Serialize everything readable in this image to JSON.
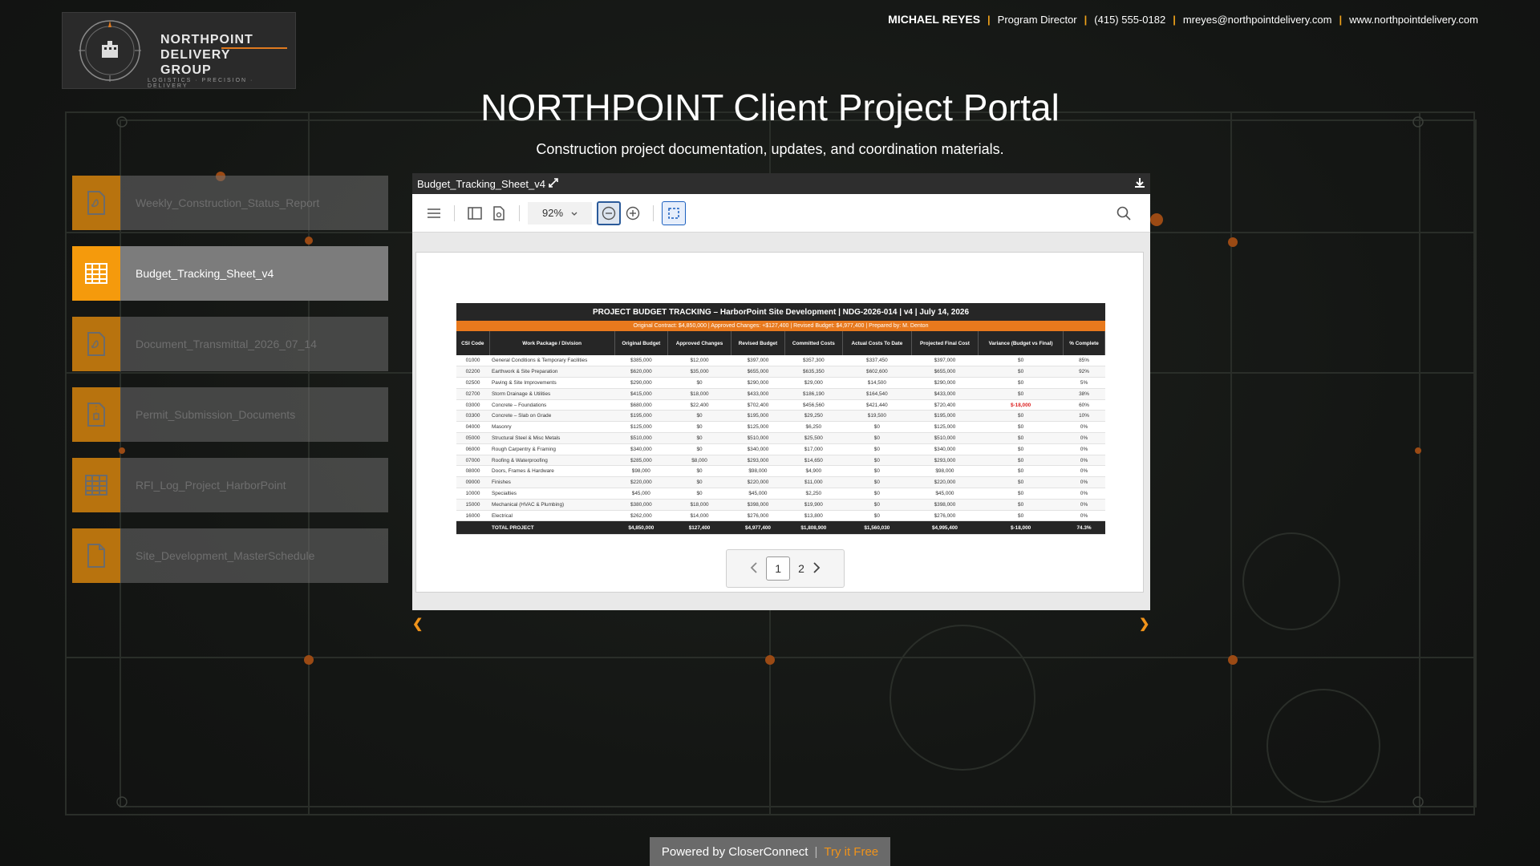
{
  "logo": {
    "brand_line1": "NORTHPOINT",
    "brand_line2": "DELIVERY",
    "brand_line3": "GROUP",
    "tagline": "LOGISTICS · PRECISION · DELIVERY"
  },
  "contact": {
    "name": "MICHAEL REYES",
    "role": "Program Director",
    "phone": "(415) 555-0182",
    "email": "mreyes@northpointdelivery.com",
    "website": "www.northpointdelivery.com"
  },
  "title": "NORTHPOINT Client Project Portal",
  "subtitle": "Construction project documentation, updates, and coordination materials.",
  "documents": [
    {
      "label": "Weekly_Construction_Status_Report",
      "icon": "pdf-icon"
    },
    {
      "label": "Budget_Tracking_Sheet_v4",
      "icon": "spreadsheet-icon",
      "active": true
    },
    {
      "label": "Document_Transmittal_2026_07_14",
      "icon": "pdf-icon"
    },
    {
      "label": "Permit_Submission_Documents",
      "icon": "zip-icon"
    },
    {
      "label": "RFI_Log_Project_HarborPoint",
      "icon": "spreadsheet-icon"
    },
    {
      "label": "Site_Development_MasterSchedule",
      "icon": "file-icon"
    }
  ],
  "viewer": {
    "filename": "Budget_Tracking_Sheet_v4",
    "zoom": "92%",
    "current_page": "1",
    "next_page": "2"
  },
  "sheet": {
    "title": "PROJECT BUDGET TRACKING  –  HarborPoint Site Development  |  NDG-2026-014  |  v4  |  July 14, 2026",
    "subtitle": "Original Contract: $4,850,000  |  Approved Changes: +$127,400  |  Revised Budget: $4,977,400  |  Prepared by: M. Denton",
    "headers": [
      "CSI Code",
      "Work Package / Division",
      "Original Budget",
      "Approved Changes",
      "Revised Budget",
      "Committed Costs",
      "Actual Costs To Date",
      "Projected Final Cost",
      "Variance (Budget vs Final)",
      "% Complete"
    ],
    "rows": [
      [
        "01000",
        "General Conditions & Temporary Facilities",
        "$385,000",
        "$12,000",
        "$397,000",
        "$357,300",
        "$337,450",
        "$397,000",
        "$0",
        "85%"
      ],
      [
        "02200",
        "Earthwork & Site Preparation",
        "$620,000",
        "$35,000",
        "$655,000",
        "$635,350",
        "$602,600",
        "$655,000",
        "$0",
        "92%"
      ],
      [
        "02500",
        "Paving & Site Improvements",
        "$290,000",
        "$0",
        "$290,000",
        "$29,000",
        "$14,500",
        "$290,000",
        "$0",
        "5%"
      ],
      [
        "02700",
        "Storm Drainage & Utilities",
        "$415,000",
        "$18,000",
        "$433,000",
        "$186,190",
        "$164,540",
        "$433,000",
        "$0",
        "38%"
      ],
      [
        "03000",
        "Concrete – Foundations",
        "$680,000",
        "$22,400",
        "$702,400",
        "$456,560",
        "$421,440",
        "$720,400",
        "$-18,000",
        "60%"
      ],
      [
        "03300",
        "Concrete – Slab on Grade",
        "$195,000",
        "$0",
        "$195,000",
        "$29,250",
        "$19,500",
        "$195,000",
        "$0",
        "10%"
      ],
      [
        "04000",
        "Masonry",
        "$125,000",
        "$0",
        "$125,000",
        "$6,250",
        "$0",
        "$125,000",
        "$0",
        "0%"
      ],
      [
        "05000",
        "Structural Steel & Misc Metals",
        "$510,000",
        "$0",
        "$510,000",
        "$25,500",
        "$0",
        "$510,000",
        "$0",
        "0%"
      ],
      [
        "06000",
        "Rough Carpentry & Framing",
        "$340,000",
        "$0",
        "$340,000",
        "$17,000",
        "$0",
        "$340,000",
        "$0",
        "0%"
      ],
      [
        "07000",
        "Roofing & Waterproofing",
        "$285,000",
        "$8,000",
        "$293,000",
        "$14,650",
        "$0",
        "$293,000",
        "$0",
        "0%"
      ],
      [
        "08000",
        "Doors, Frames & Hardware",
        "$98,000",
        "$0",
        "$98,000",
        "$4,900",
        "$0",
        "$98,000",
        "$0",
        "0%"
      ],
      [
        "09000",
        "Finishes",
        "$220,000",
        "$0",
        "$220,000",
        "$11,000",
        "$0",
        "$220,000",
        "$0",
        "0%"
      ],
      [
        "10000",
        "Specialties",
        "$45,000",
        "$0",
        "$45,000",
        "$2,250",
        "$0",
        "$45,000",
        "$0",
        "0%"
      ],
      [
        "15000",
        "Mechanical (HVAC & Plumbing)",
        "$380,000",
        "$18,000",
        "$398,000",
        "$19,900",
        "$0",
        "$398,000",
        "$0",
        "0%"
      ],
      [
        "16000",
        "Electrical",
        "$262,000",
        "$14,000",
        "$276,000",
        "$13,800",
        "$0",
        "$276,000",
        "$0",
        "0%"
      ]
    ],
    "total": [
      "",
      "TOTAL PROJECT",
      "$4,850,000",
      "$127,400",
      "$4,977,400",
      "$1,808,900",
      "$1,560,030",
      "$4,995,400",
      "$-18,000",
      "74.3%"
    ]
  },
  "footer": {
    "powered": "Powered by CloserConnect",
    "try": "Try it Free"
  },
  "colors": {
    "accent": "#f59a0c",
    "sheet_orange": "#e8791d",
    "negative": "#dd2222"
  }
}
